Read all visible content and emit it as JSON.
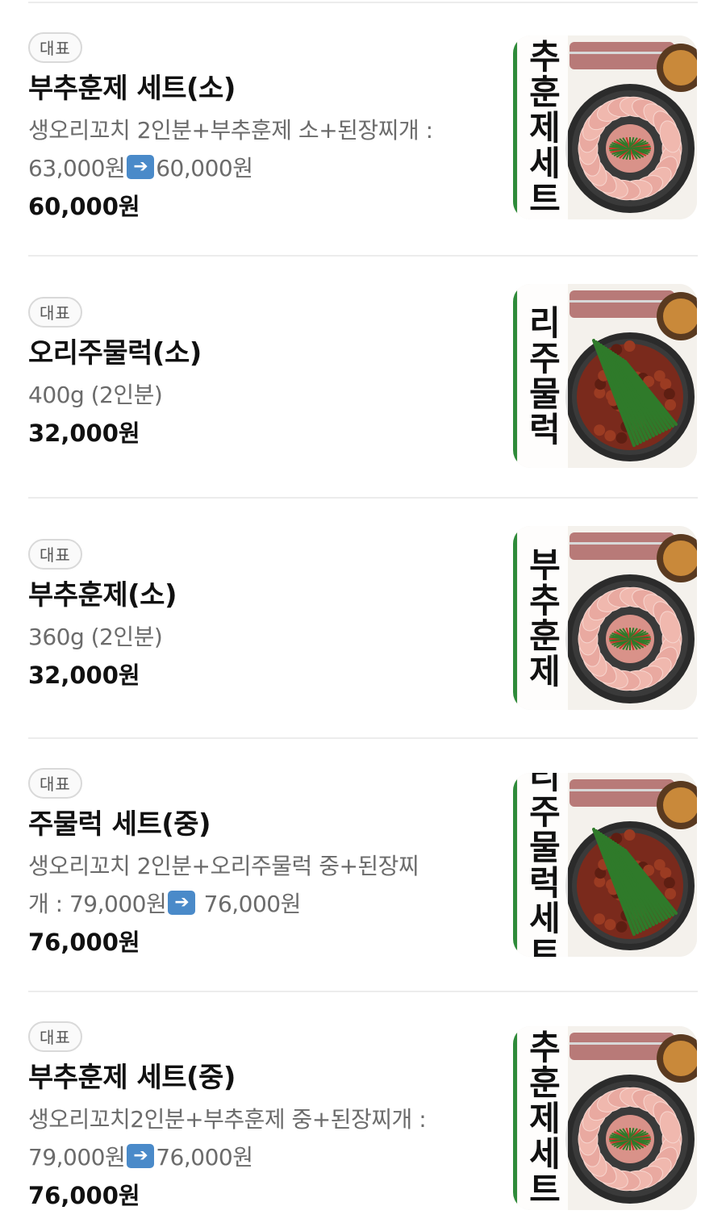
{
  "menu": {
    "items": [
      {
        "badge": "대표",
        "name": "부추훈제 세트(소)",
        "desc_line1": "생오리꼬치 2인분+부추훈제 소+된장찌개 :",
        "desc_before": "63,000원",
        "desc_after": "60,000원",
        "price": "60,000원",
        "image_text": "추훈제세트",
        "dish": "smoked-duck"
      },
      {
        "badge": "대표",
        "name": "오리주물럭(소)",
        "desc": "400g (2인분)",
        "price": "32,000원",
        "image_text": "리주물럭",
        "dish": "spicy-duck"
      },
      {
        "badge": "대표",
        "name": "부추훈제(소)",
        "desc": "360g (2인분)",
        "price": "32,000원",
        "image_text": "부추훈제",
        "dish": "smoked-duck"
      },
      {
        "badge": "대표",
        "name": "주물럭 세트(중)",
        "desc_line1": "생오리꼬치 2인분+오리주물럭 중+된장찌",
        "desc_before": "개 : 79,000원",
        "desc_after": " 76,000원",
        "price": "76,000원",
        "image_text": "리주물럭세트",
        "dish": "spicy-duck"
      },
      {
        "badge": "대표",
        "name": "부추훈제 세트(중)",
        "desc_line1": "생오리꼬치2인분+부추훈제 중+된장찌개 :",
        "desc_before": "79,000원",
        "desc_after": "76,000원",
        "price": "76,000원",
        "image_text": "추훈제세트",
        "dish": "smoked-duck"
      }
    ]
  },
  "colors": {
    "smoked_slice": "#e9a9a0",
    "spicy_sauce": "#7a2a1c",
    "chive_green": "#2f7a2a",
    "pan_dark": "#2b2b2b",
    "accent_green": "#2e8b3a"
  }
}
